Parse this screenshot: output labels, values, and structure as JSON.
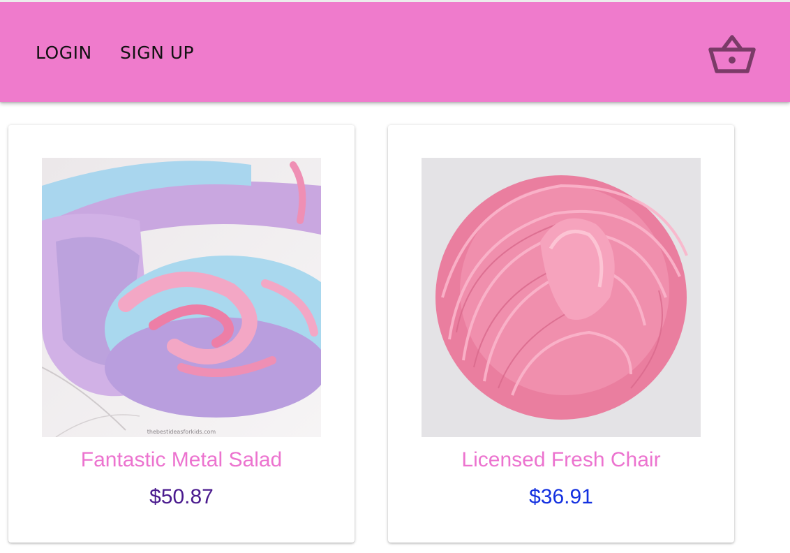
{
  "header": {
    "login_label": "LOGIN",
    "signup_label": "SIGN UP",
    "cart_icon": "shopping-basket-icon",
    "background_color": "#ef7bcc"
  },
  "products": [
    {
      "name": "Fantastic Metal Salad",
      "price": "$50.87",
      "image": "pastel-slime-swirl",
      "watermark": "thebestideasforkids.com",
      "price_color": "#4a1a8e"
    },
    {
      "name": "Licensed Fresh Chair",
      "price": "$36.91",
      "image": "pink-slime-swirl",
      "price_color": "#1330e0"
    }
  ]
}
